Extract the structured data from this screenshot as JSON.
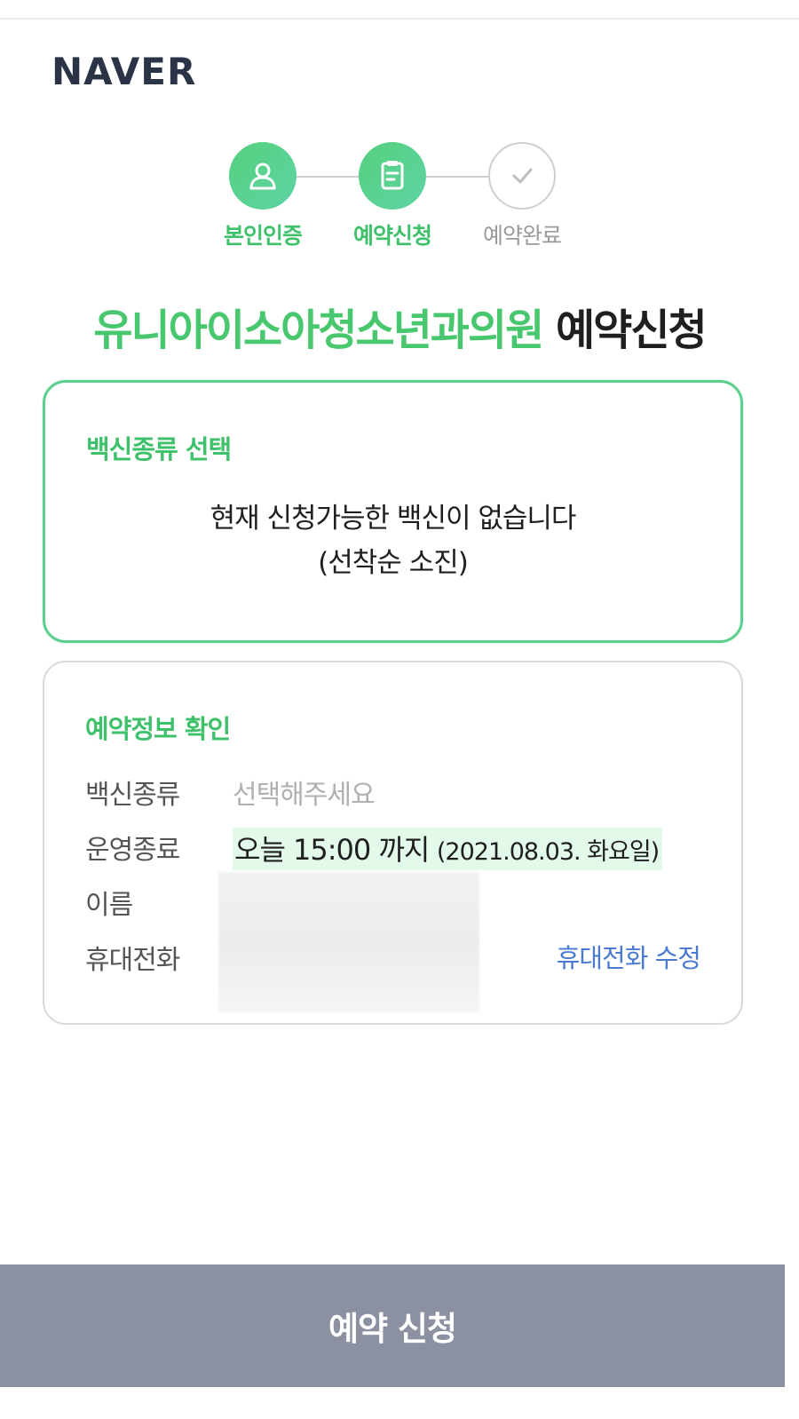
{
  "header": {
    "logo_text": "NAVER"
  },
  "steps": [
    {
      "label": "본인인증",
      "state": "done",
      "icon": "user-icon"
    },
    {
      "label": "예약신청",
      "state": "current",
      "icon": "clipboard-icon"
    },
    {
      "label": "예약완료",
      "state": "pending",
      "icon": "check-icon"
    }
  ],
  "title": {
    "clinic": "유니아이소아청소년과의원",
    "action": "예약신청"
  },
  "vaccine_section": {
    "title": "백신종류 선택",
    "empty_line1": "현재 신청가능한 백신이 없습니다",
    "empty_line2": "(선착순 소진)"
  },
  "info_section": {
    "title": "예약정보 확인",
    "vaccine_label": "백신종류",
    "vaccine_value": "선택해주세요",
    "hours_label": "운영종료",
    "hours_today": "오늘 15:00 까지",
    "hours_date": "(2021.08.03. 화요일)",
    "name_label": "이름",
    "phone_label": "휴대전화",
    "edit_phone": "휴대전화 수정"
  },
  "submit_label": "예약 신청",
  "colors": {
    "accent_green": "#48c76f",
    "border_green": "#5ccf8f",
    "link_blue": "#4a7bd0",
    "button_gray": "#8b91a1",
    "logo_navy": "#2b3347"
  }
}
